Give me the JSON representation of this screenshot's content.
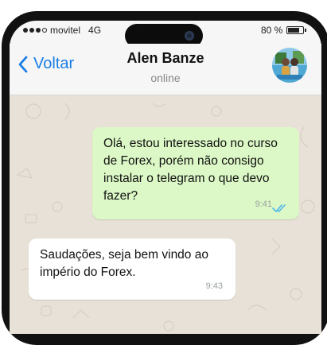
{
  "status": {
    "carrier": "movitel",
    "network": "4G",
    "battery_text": "80 %",
    "battery_level": 0.8
  },
  "header": {
    "back_label": "Voltar",
    "contact_name": "Alen Banze",
    "contact_status": "online"
  },
  "messages": [
    {
      "direction": "outgoing",
      "text": "Olá, estou interessado no curso de Forex, porém não consigo instalar o telegram o que devo fazer?",
      "time": "9:41",
      "read": true
    },
    {
      "direction": "incoming",
      "text": "Saudações, seja bem vindo ao império do Forex.",
      "time": "9:43"
    }
  ],
  "colors": {
    "accent": "#1a7ee6",
    "outgoing_bubble": "#dcf8c6",
    "incoming_bubble": "#ffffff",
    "chat_background": "#e8e1d7",
    "read_ticks": "#4fb6ec"
  }
}
